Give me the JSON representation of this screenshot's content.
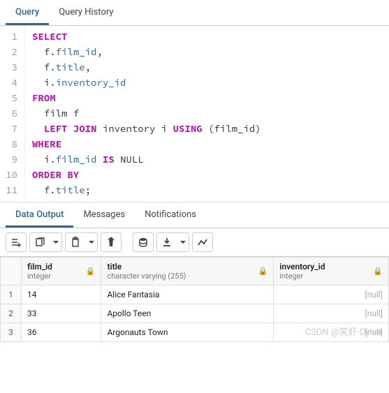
{
  "tabs": {
    "query": "Query",
    "history": "Query History"
  },
  "sql": {
    "select": "SELECT",
    "from": "FROM",
    "left_join": "LEFT JOIN",
    "using": "USING",
    "where": "WHERE",
    "is": "IS",
    "null": "NULL",
    "order_by": "ORDER BY",
    "f": "f",
    "i": "i",
    "film_id": "film_id",
    "title": "title",
    "inventory_id": "inventory_id",
    "film": "film",
    "inventory": "inventory"
  },
  "lines": {
    "l1": "1",
    "l2": "2",
    "l3": "3",
    "l4": "4",
    "l5": "5",
    "l6": "6",
    "l7": "7",
    "l8": "8",
    "l9": "9",
    "l10": "10",
    "l11": "11"
  },
  "output_tabs": {
    "data": "Data Output",
    "messages": "Messages",
    "notifications": "Notifications"
  },
  "columns": {
    "film_id": {
      "name": "film_id",
      "type": "integer"
    },
    "title": {
      "name": "title",
      "type": "character varying (255)"
    },
    "inventory_id": {
      "name": "inventory_id",
      "type": "integer"
    }
  },
  "rows": [
    {
      "n": "1",
      "film_id": "14",
      "title": "Alice Fantasia",
      "inventory_id": "[null]"
    },
    {
      "n": "2",
      "film_id": "33",
      "title": "Apollo Teen",
      "inventory_id": "[null]"
    },
    {
      "n": "3",
      "film_id": "36",
      "title": "Argonauts Town",
      "inventory_id": "[null]"
    }
  ],
  "watermark": "CSDN @笑虾-Dylen"
}
